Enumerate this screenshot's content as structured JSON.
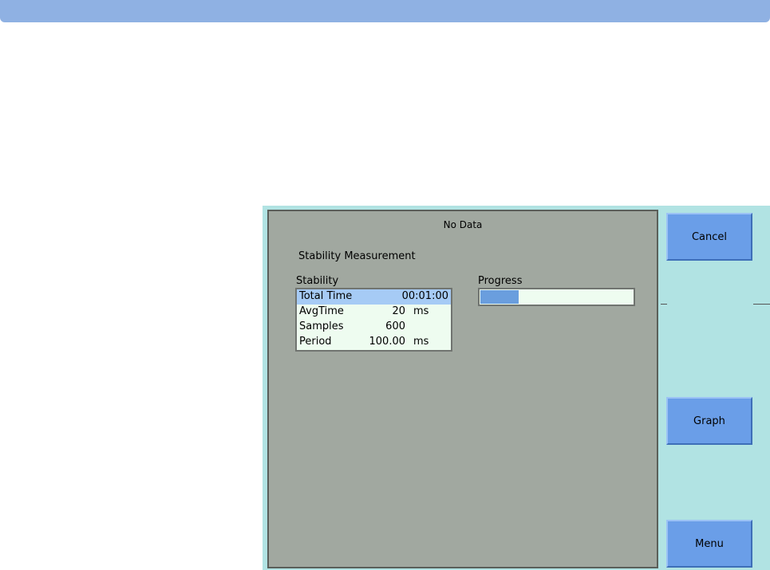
{
  "panel": {
    "title": "No Data",
    "subtitle": "Stability Measurement"
  },
  "stability": {
    "label": "Stability",
    "rows": [
      {
        "name": "Total Time",
        "value": "00:01:00",
        "unit": ""
      },
      {
        "name": "AvgTime",
        "value": "20",
        "unit": "ms"
      },
      {
        "name": "Samples",
        "value": "600",
        "unit": ""
      },
      {
        "name": "Period",
        "value": "100.00",
        "unit": "ms"
      }
    ]
  },
  "progress": {
    "label": "Progress",
    "fraction": 0.25
  },
  "softkeys": {
    "cancel": "Cancel",
    "graph": "Graph",
    "menu": "Menu"
  },
  "colors": {
    "topbar": "#8fb1e3",
    "screen_background": "#b1e3e3",
    "panel_background": "#a1a8a0",
    "field_background": "#eefcf0",
    "selection": "#a6cbf5",
    "progress_fill": "#6a9ede",
    "softkey": "#6a9ee8"
  }
}
